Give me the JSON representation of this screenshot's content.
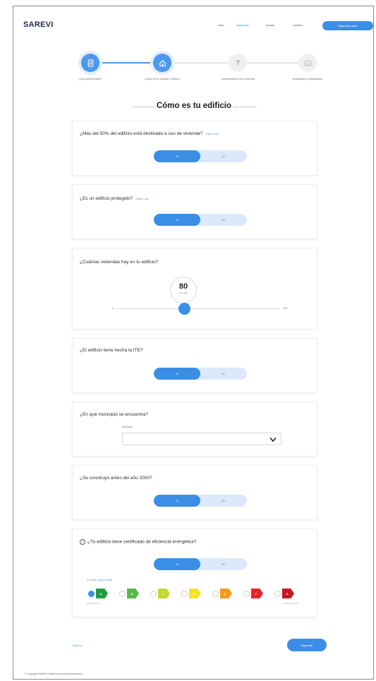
{
  "brand": "SAREVI",
  "nav": {
    "items": [
      "Inicio",
      "Diagnóstico",
      "Ayudas",
      "Contacto"
    ],
    "cta": "Diagnóstico gratis"
  },
  "steps": [
    {
      "label": "¿Qué quieres hacer?",
      "status": "done"
    },
    {
      "label": "¿Cómo es tu vivienda / edificio?",
      "status": "current"
    },
    {
      "label": "Características de la vivienda",
      "status": "pending"
    },
    {
      "label": "Resultados y presentación",
      "status": "pending"
    }
  ],
  "page_title": "Cómo es tu edificio",
  "questions": {
    "vivienda": {
      "text": "¿Más del 50% del edificio está destinado a uso de vivienda?",
      "help": "Saber más",
      "yes": "Sí",
      "no": "No",
      "value": "Sí"
    },
    "protegido": {
      "text": "¿Es un edificio protegido?",
      "help": "Saber más",
      "yes": "Sí",
      "no": "No",
      "value": "Sí"
    },
    "viviendas": {
      "text": "¿Cuántas viviendas hay en tu edificio?",
      "value": "80",
      "unit": "viviendas",
      "min": "4",
      "max": "200"
    },
    "ite": {
      "text": "¿El edificio tiene hecha la ITE?",
      "yes": "Sí",
      "no": "No",
      "value": "Sí"
    },
    "municipio": {
      "text": "¿En qué municipio se encuentra?",
      "label": "Municipio",
      "value": ""
    },
    "antes2000": {
      "text": "¿Se construyó antes del año 2000?",
      "yes": "Sí",
      "no": "No",
      "value": "Sí"
    },
    "certificado": {
      "text": "¿Tu edificio tiene certificado de eficiencia energética?",
      "yes": "Sí",
      "no": "No",
      "value": "Sí",
      "hint_prefix": "Por favor,",
      "hint_link": "elige la letra",
      "scale_min": "Más eficiente",
      "scale_max": "Menos eficiente",
      "selected": "A",
      "ratings": [
        {
          "letter": "A",
          "color": "#1e9e3e"
        },
        {
          "letter": "B",
          "color": "#56b947"
        },
        {
          "letter": "C",
          "color": "#c4d82e"
        },
        {
          "letter": "D",
          "color": "#f5e22b"
        },
        {
          "letter": "E",
          "color": "#f39a1e"
        },
        {
          "letter": "F",
          "color": "#e8232a"
        },
        {
          "letter": "G",
          "color": "#c2191f"
        }
      ]
    }
  },
  "footer": {
    "back": "Anterior",
    "next": "Siguiente",
    "copyright": "© Copyright SAREVI Todos los derechos reservados"
  },
  "colors": {
    "primary": "#3b8ee6",
    "primary_light": "#dbe9fb"
  }
}
